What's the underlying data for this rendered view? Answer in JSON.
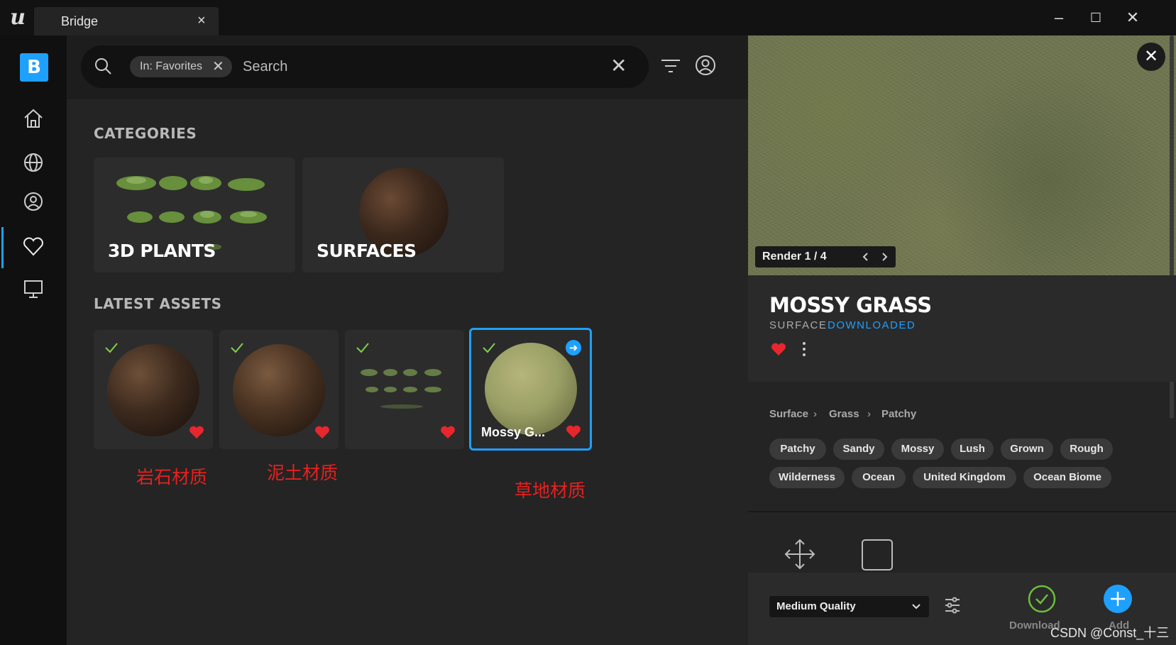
{
  "window": {
    "tab_title": "Bridge",
    "tab_close": "×",
    "controls": {
      "minimize": "–",
      "maximize": "☐",
      "close": "✕"
    },
    "logo_text": "u"
  },
  "rail": {
    "logo_text": "B",
    "items": [
      {
        "name": "home-icon"
      },
      {
        "name": "globe-icon"
      },
      {
        "name": "user-icon"
      },
      {
        "name": "heart-icon",
        "active": true
      },
      {
        "name": "monitor-icon"
      }
    ]
  },
  "search": {
    "chip_label": "In: Favorites",
    "chip_remove": "✕",
    "placeholder": "Search",
    "clear": "✕"
  },
  "categories": {
    "title": "CATEGORIES",
    "items": [
      {
        "label": "3D PLANTS"
      },
      {
        "label": "SURFACES"
      }
    ]
  },
  "latest": {
    "title": "LATEST ASSETS",
    "items": [
      {
        "label": "",
        "downloaded": true,
        "favorite": true,
        "color": "#3d2a1e"
      },
      {
        "label": "",
        "downloaded": true,
        "favorite": true,
        "color": "#4a3322"
      },
      {
        "label": "",
        "downloaded": true,
        "favorite": true,
        "color": "#6f8a4a"
      },
      {
        "label": "Mossy G...",
        "downloaded": true,
        "favorite": true,
        "selected": true,
        "color": "#9aa066"
      }
    ]
  },
  "annotations": [
    "岩石材质",
    "泥土材质",
    "草地材质"
  ],
  "detail": {
    "render_label": "Render 1 / 4",
    "close": "✕",
    "title": "MOSSY GRASS",
    "type": "SURFACE",
    "status": "DOWNLOADED",
    "breadcrumb": [
      "Surface",
      "Grass",
      "Patchy"
    ],
    "tags": [
      "Patchy",
      "Sandy",
      "Mossy",
      "Lush",
      "Grown",
      "Rough",
      "Wilderness",
      "Ocean",
      "United Kingdom",
      "Ocean Biome"
    ],
    "quality": "Medium Quality",
    "download_label": "Download",
    "add_label": "Add"
  },
  "watermark": "CSDN @Const_十三",
  "colors": {
    "accent": "#1ea0ff",
    "favorite": "#e8262e",
    "check": "#7fd14e",
    "annotation": "#e8201f"
  }
}
